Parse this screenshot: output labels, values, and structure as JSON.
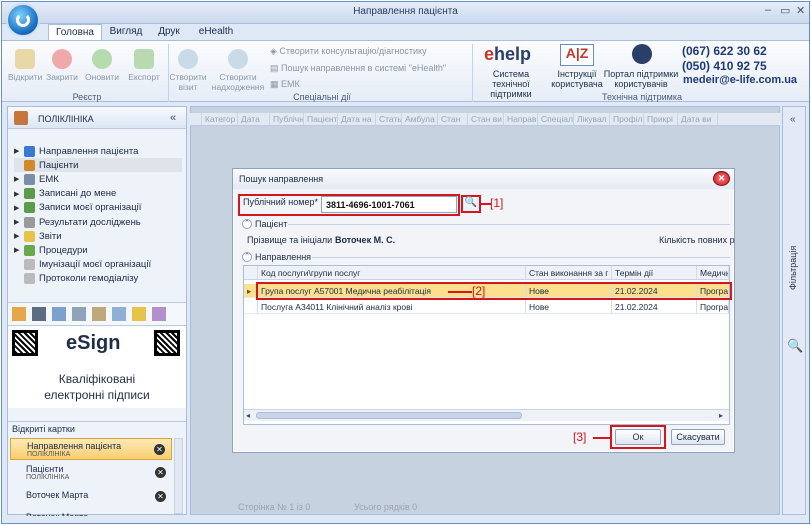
{
  "window": {
    "title": "Направлення пацієнта"
  },
  "ribbon": {
    "tabs": [
      "Головна",
      "Вигляд",
      "Друк",
      "eHealth"
    ],
    "groups": {
      "registry": "Реєстр",
      "special": "Спеціальні дії",
      "support": "Технічна підтримка"
    },
    "registry_buttons": [
      "Відкрити",
      "Закрити",
      "Оновити",
      "Експорт"
    ],
    "special_buttons": [
      "Створити візит",
      "Створити надходження"
    ],
    "special_small": [
      "Створити консультацію/діагностику",
      "Пошук направлення в системі \"eHealth\"",
      "ЕМК"
    ],
    "support_buttons": [
      "Система технічної підтримки",
      "Інструкції користувача",
      "Портал підтримки користувачів"
    ],
    "logo_help": "help",
    "logo_help_e": "e",
    "logo_az": "A|Z",
    "phones": [
      "(067) 622 30 62",
      "(050) 410 92 75"
    ],
    "email": "medeir@e-life.com.ua"
  },
  "left_panel": {
    "title": "ПОЛІКЛІНІКА",
    "nav": [
      {
        "label": "Направлення пацієнта",
        "arrow": true
      },
      {
        "label": "Пацієнти",
        "arrow": false
      },
      {
        "label": "ЕМК",
        "arrow": true
      },
      {
        "label": "Записані до мене",
        "arrow": true
      },
      {
        "label": "Записи моєї організації",
        "arrow": true
      },
      {
        "label": "Результати досліджень",
        "arrow": true
      },
      {
        "label": "Звіти",
        "arrow": true
      },
      {
        "label": "Процедури",
        "arrow": true
      },
      {
        "label": "Імунізації моєї організації",
        "arrow": false
      },
      {
        "label": "Протоколи гемодіалізу",
        "arrow": false
      }
    ],
    "esign_brand": "eSign",
    "esign_text": [
      "Кваліфіковані",
      "електронні підписи"
    ],
    "open_cards_title": "Відкриті картки",
    "open_cards": [
      {
        "label": "Направлення пацієнта",
        "sub": "ПОЛІКЛІНІКА"
      },
      {
        "label": "Пацієнти",
        "sub": "ПОЛІКЛІНІКА"
      },
      {
        "label": "Воточек Марта",
        "sub": ""
      },
      {
        "label": "Воточек Марта",
        "sub": ""
      }
    ]
  },
  "main_grid": {
    "columns": [
      "Категор",
      "Дата",
      "Публічн",
      "Пацієнт",
      "Дата на",
      "Стать",
      "Амбула",
      "Стан",
      "Стан ви",
      "Направ",
      "Спеціал",
      "Лікувал",
      "Профіл",
      "Прикрі",
      "Дата ви"
    ],
    "status": "Сторінка № 1 із 0",
    "rows_total": "Усього рядків 0"
  },
  "filter_panel": {
    "label": "Фільтрація"
  },
  "dialog": {
    "title": "Пошук направлення",
    "public_number_label": "Публічний номер*",
    "public_number_value": "3811-4696-1001-7061",
    "patient_section": "Пацієнт",
    "patient_label": "Прізвище та ініціали",
    "patient_value": "Воточек М. С.",
    "visits_label": "Кількість повних р",
    "referral_section": "Направлення",
    "columns": [
      "Код послуги\\групи послуг",
      "Стан виконання за г",
      "Термін дії",
      "Медичн"
    ],
    "rows": [
      {
        "code": "Група послуг A57001 Медична реабілітація",
        "state": "Нове",
        "term": "21.02.2024",
        "med": "Програ"
      },
      {
        "code": "Послуга A34011 Клінічний аналіз крові",
        "state": "Нове",
        "term": "21.02.2024",
        "med": "Програ"
      }
    ],
    "ok": "Ок",
    "cancel": "Скасувати",
    "markers": [
      "[1]",
      "[2]",
      "[3]"
    ]
  },
  "colors": {
    "accent": "#1a6fc0",
    "highlight_row": "#fce08d",
    "annotation": "#d4161e"
  }
}
